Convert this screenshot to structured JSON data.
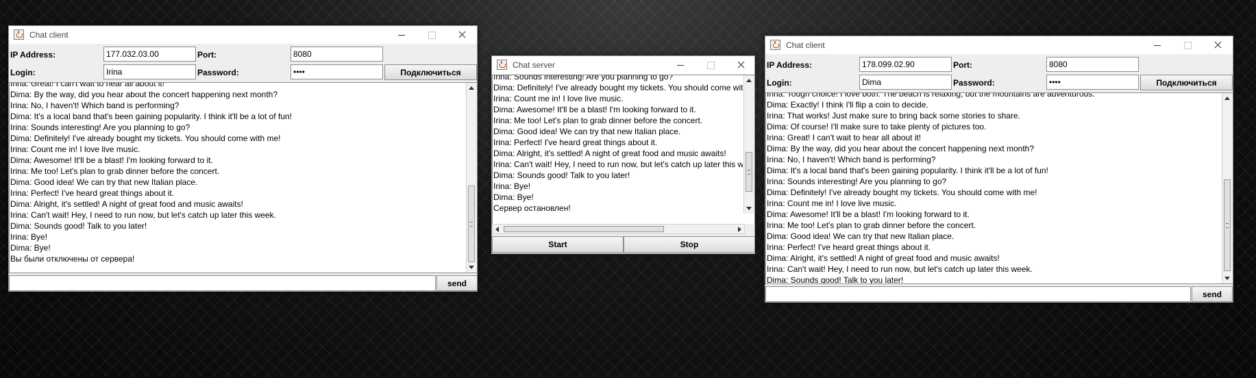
{
  "client1": {
    "title": "Chat client",
    "ip_label": "IP Address:",
    "ip_value": "177.032.03.00",
    "port_label": "Port:",
    "port_value": "8080",
    "login_label": "Login:",
    "login_value": "Irina",
    "password_label": "Password:",
    "password_value": "••••",
    "connect_label": "Подключиться",
    "send_label": "send",
    "messages": [
      "Irina: Great! I can't wait to hear all about it!",
      "Dima: By the way, did you hear about the concert happening next month?",
      "Irina: No, I haven't! Which band is performing?",
      "Dima: It's a local band that's been gaining popularity. I think it'll be a lot of fun!",
      "Irina: Sounds interesting! Are you planning to go?",
      "Dima: Definitely! I've already bought my tickets. You should come with me!",
      "Irina: Count me in! I love live music.",
      "Dima: Awesome! It'll be a blast! I'm looking forward to it.",
      "Irina: Me too! Let's plan to grab dinner before the concert.",
      "Dima: Good idea! We can try that new Italian place.",
      "Irina: Perfect! I've heard great things about it.",
      "Dima: Alright, it's settled! A night of great food and music awaits!",
      "Irina: Can't wait! Hey, I need to run now, but let's catch up later this week.",
      "Dima: Sounds good! Talk to you later!",
      "Irina: Bye!",
      "Dima: Bye!",
      "Вы были отключены от сервера!"
    ]
  },
  "server": {
    "title": "Chat server",
    "start_label": "Start",
    "stop_label": "Stop",
    "messages": [
      "Irina: Sounds interesting! Are you planning to go?",
      "Dima: Definitely! I've already bought my tickets. You should come with me!",
      "Irina: Count me in! I love live music.",
      "Dima: Awesome! It'll be a blast! I'm looking forward to it.",
      "Irina: Me too! Let's plan to grab dinner before the concert.",
      "Dima: Good idea! We can try that new Italian place.",
      "Irina: Perfect! I've heard great things about it.",
      "Dima: Alright, it's settled! A night of great food and music awaits!",
      "Irina: Can't wait! Hey, I need to run now, but let's catch up later this week.",
      "Dima: Sounds good! Talk to you later!",
      "Irina: Bye!",
      "Dima: Bye!",
      "Сервер остановлен!"
    ]
  },
  "client2": {
    "title": "Chat client",
    "ip_label": "IP Address:",
    "ip_value": "178.099.02.90",
    "port_label": "Port:",
    "port_value": "8080",
    "login_label": "Login:",
    "login_value": "Dima",
    "password_label": "Password:",
    "password_value": "••••",
    "connect_label": "Подключиться",
    "send_label": "send",
    "messages": [
      "Irina: Tough choice! I love both. The beach is relaxing, but the mountains are adventurous.",
      "Dima: Exactly! I think I'll flip a coin to decide.",
      "Irina: That works! Just make sure to bring back some stories to share.",
      "Dima: Of course! I'll make sure to take plenty of pictures too.",
      "Irina: Great! I can't wait to hear all about it!",
      "Dima: By the way, did you hear about the concert happening next month?",
      "Irina: No, I haven't! Which band is performing?",
      "Dima: It's a local band that's been gaining popularity. I think it'll be a lot of fun!",
      "Irina: Sounds interesting! Are you planning to go?",
      "Dima: Definitely! I've already bought my tickets. You should come with me!",
      "Irina: Count me in! I love live music.",
      "Dima: Awesome! It'll be a blast! I'm looking forward to it.",
      "Irina: Me too! Let's plan to grab dinner before the concert.",
      "Dima: Good idea! We can try that new Italian place.",
      "Irina: Perfect! I've heard great things about it.",
      "Dima: Alright, it's settled! A night of great food and music awaits!",
      "Irina: Can't wait! Hey, I need to run now, but let's catch up later this week.",
      "Dima: Sounds good! Talk to you later!"
    ]
  }
}
